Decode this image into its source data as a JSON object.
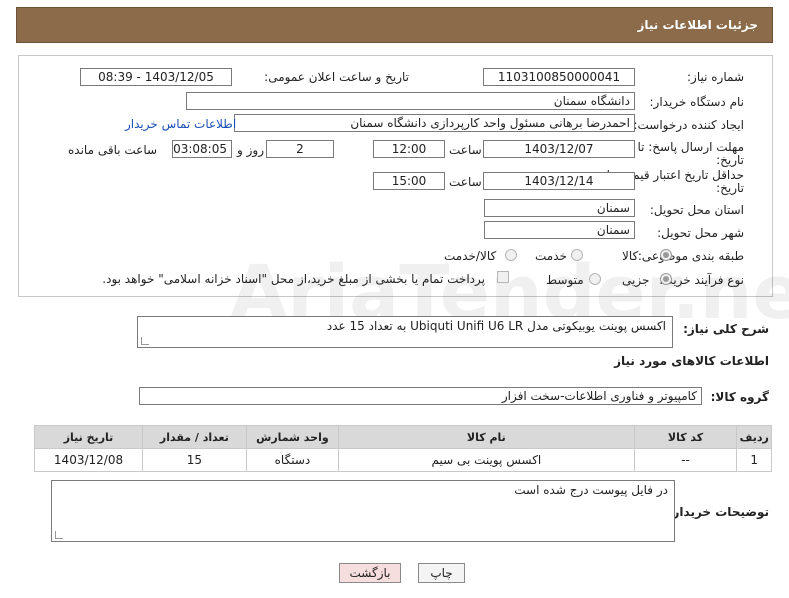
{
  "header": {
    "title": "جزئیات اطلاعات نیاز"
  },
  "fields": {
    "need_number_label": "شماره نیاز:",
    "need_number": "1103100850000041",
    "announce_label": "تاریخ و ساعت اعلان عمومی:",
    "announce_value": "1403/12/05 - 08:39",
    "buyer_org_label": "نام دستگاه خریدار:",
    "buyer_org": "دانشگاه سمنان",
    "requester_label": "ایجاد کننده درخواست:",
    "requester": "احمدرضا برهانی مسئول واحد کارپردازی دانشگاه سمنان",
    "contact_link": "اطلاعات تماس خریدار",
    "deadline_label_1": "مهلت ارسال پاسخ: تا",
    "deadline_label_2": "تاریخ:",
    "deadline_date": "1403/12/07",
    "time_label": "ساعت",
    "deadline_time": "12:00",
    "days_value": "2",
    "days_label": "روز و",
    "remaining_value": "03:08:05",
    "remaining_label": "ساعت باقی مانده",
    "price_validity_label_1": "حداقل تاریخ اعتبار قیمت: تا",
    "price_validity_label_2": "تاریخ:",
    "price_validity_date": "1403/12/14",
    "price_validity_time": "15:00",
    "province_label": "استان محل تحویل:",
    "province": "سمنان",
    "city_label": "شهر محل تحویل:",
    "city": "سمنان",
    "category_label": "طبقه بندی موضوعی:",
    "category_options": [
      "کالا",
      "خدمت",
      "کالا/خدمت"
    ],
    "process_label": "نوع فرآیند خرید :",
    "process_options": [
      "جزیی",
      "متوسط"
    ],
    "payment_note": "پرداخت تمام یا بخشی از مبلغ خرید،از محل \"اسناد خزانه اسلامی\" خواهد بود."
  },
  "description": {
    "label": "شرح کلی نیاز:",
    "value": "اکسس پوینت یوبیکوتی مدل Ubiquti Unifi U6 LR  به تعداد 15 عدد"
  },
  "goods_section": {
    "title": "اطلاعات کالاهای مورد نیاز",
    "group_label": "گروه کالا:",
    "group_value": "کامپیوتر و فناوری اطلاعات-سخت افزار"
  },
  "table": {
    "headers": [
      "ردیف",
      "کد کالا",
      "نام کالا",
      "واحد شمارش",
      "تعداد / مقدار",
      "تاریخ نیاز"
    ],
    "rows": [
      [
        "1",
        "--",
        "اکسس پوینت بی سیم",
        "دستگاه",
        "15",
        "1403/12/08"
      ]
    ]
  },
  "buyer_notes": {
    "label": "توضیحات خریدار:",
    "value": "در فایل پیوست درج شده است"
  },
  "buttons": {
    "print": "چاپ",
    "back": "بازگشت"
  },
  "watermark": "AriaTender.neT",
  "colors": {
    "header_bg": "#8b6b4a",
    "link": "#1a4fb4",
    "back_button_bg": "#f7dede"
  }
}
